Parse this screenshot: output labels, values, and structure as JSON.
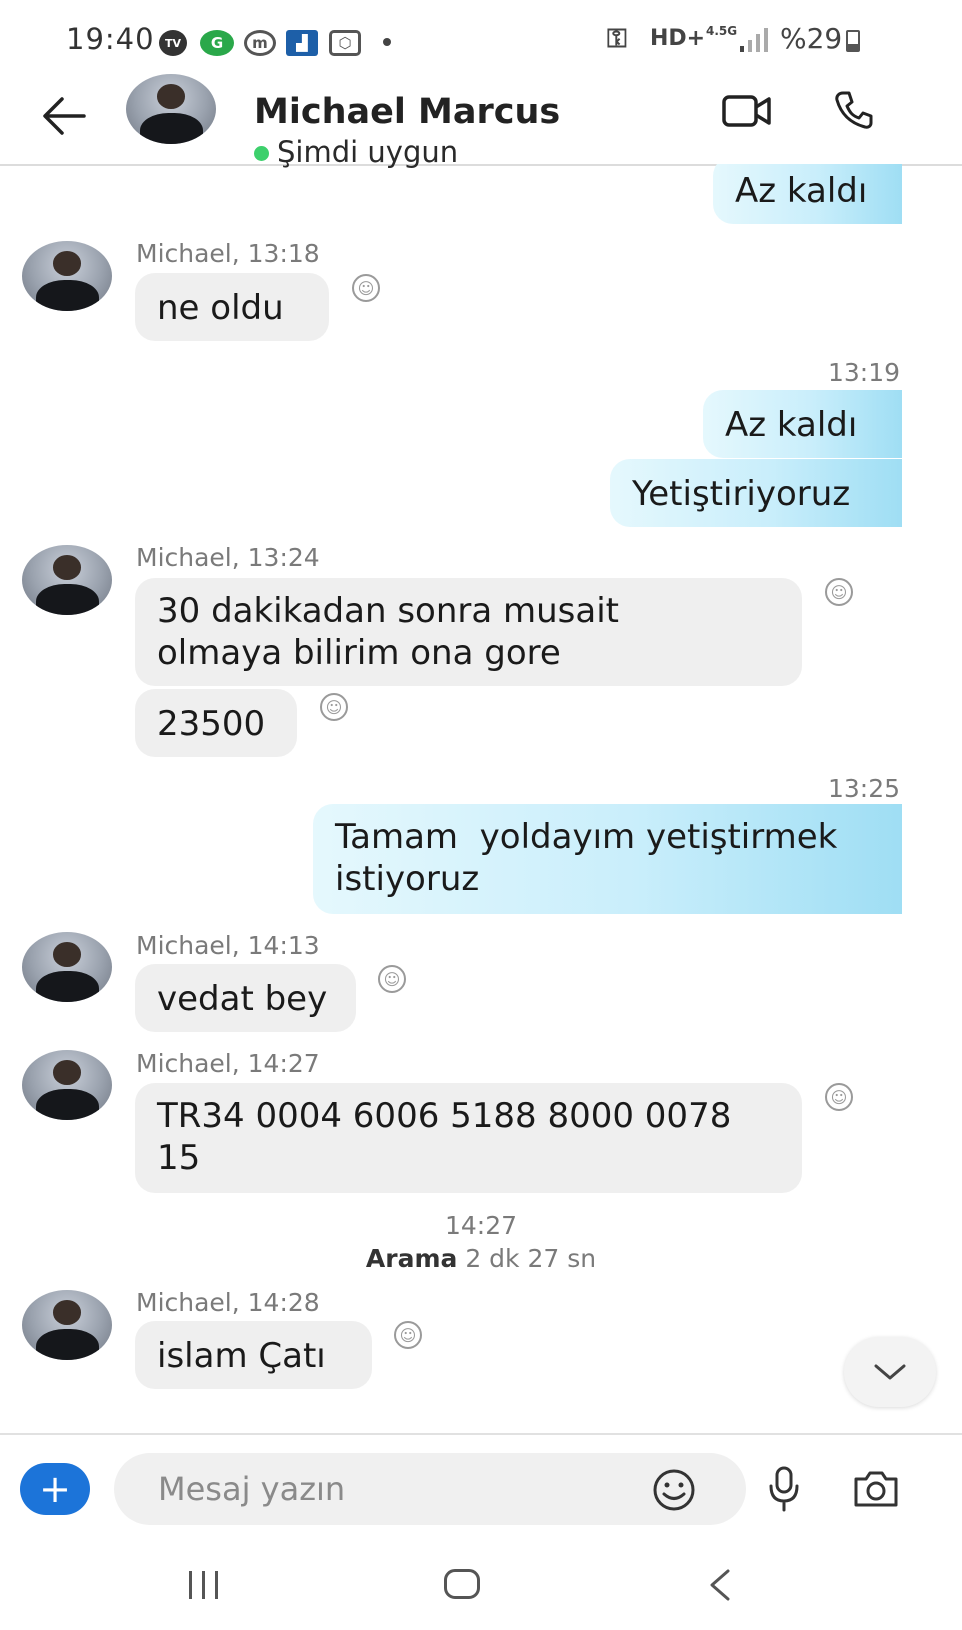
{
  "status_bar": {
    "time": "19:40",
    "network": "HD+",
    "network_type": "4.5G",
    "battery": "%29",
    "icons": [
      "tv-icon",
      "green-app-icon",
      "ring-app-icon",
      "chart-app-icon",
      "hexagon-app-icon",
      "dot-icon",
      "key-icon",
      "signal-icon",
      "battery-icon"
    ]
  },
  "header": {
    "contact_name": "Michael Marcus",
    "status": "Şimdi uygun",
    "status_color": "#3dd06c"
  },
  "messages": [
    {
      "id": "m1",
      "direction": "out",
      "text": "Az kaldı"
    },
    {
      "id": "m2",
      "direction": "in",
      "sender_time": "Michael, 13:18",
      "text": "ne oldu"
    },
    {
      "id": "m3",
      "direction": "out",
      "time": "13:19",
      "text": "Az kaldı"
    },
    {
      "id": "m4",
      "direction": "out",
      "text": "Yetiştiriyoruz"
    },
    {
      "id": "m5",
      "direction": "in",
      "sender_time": "Michael, 13:24",
      "text_line1": "30 dakikadan sonra musait",
      "text_line2": "olmaya bilirim ona gore"
    },
    {
      "id": "m6",
      "direction": "in",
      "text": "23500"
    },
    {
      "id": "m7",
      "direction": "out",
      "time": "13:25",
      "text_line1": "Tamam  yoldayım yetiştirmek",
      "text_line2": "istiyoruz"
    },
    {
      "id": "m8",
      "direction": "in",
      "sender_time": "Michael, 14:13",
      "text": "vedat bey"
    },
    {
      "id": "m9",
      "direction": "in",
      "sender_time": "Michael, 14:27",
      "text_line1": "TR34 0004 6006 5188 8000 0078",
      "text_line2": "15"
    },
    {
      "id": "m11",
      "direction": "in",
      "sender_time": "Michael, 14:28",
      "text": "islam Çatı"
    }
  ],
  "call_event": {
    "time": "14:27",
    "label": "Arama",
    "duration": "2 dk 27 sn"
  },
  "composer": {
    "placeholder": "Mesaj yazın",
    "add_label": "+"
  },
  "colors": {
    "accent": "#1c74d9",
    "incoming_bubble": "#efefef",
    "outgoing_bubble": "#c9eefb"
  }
}
